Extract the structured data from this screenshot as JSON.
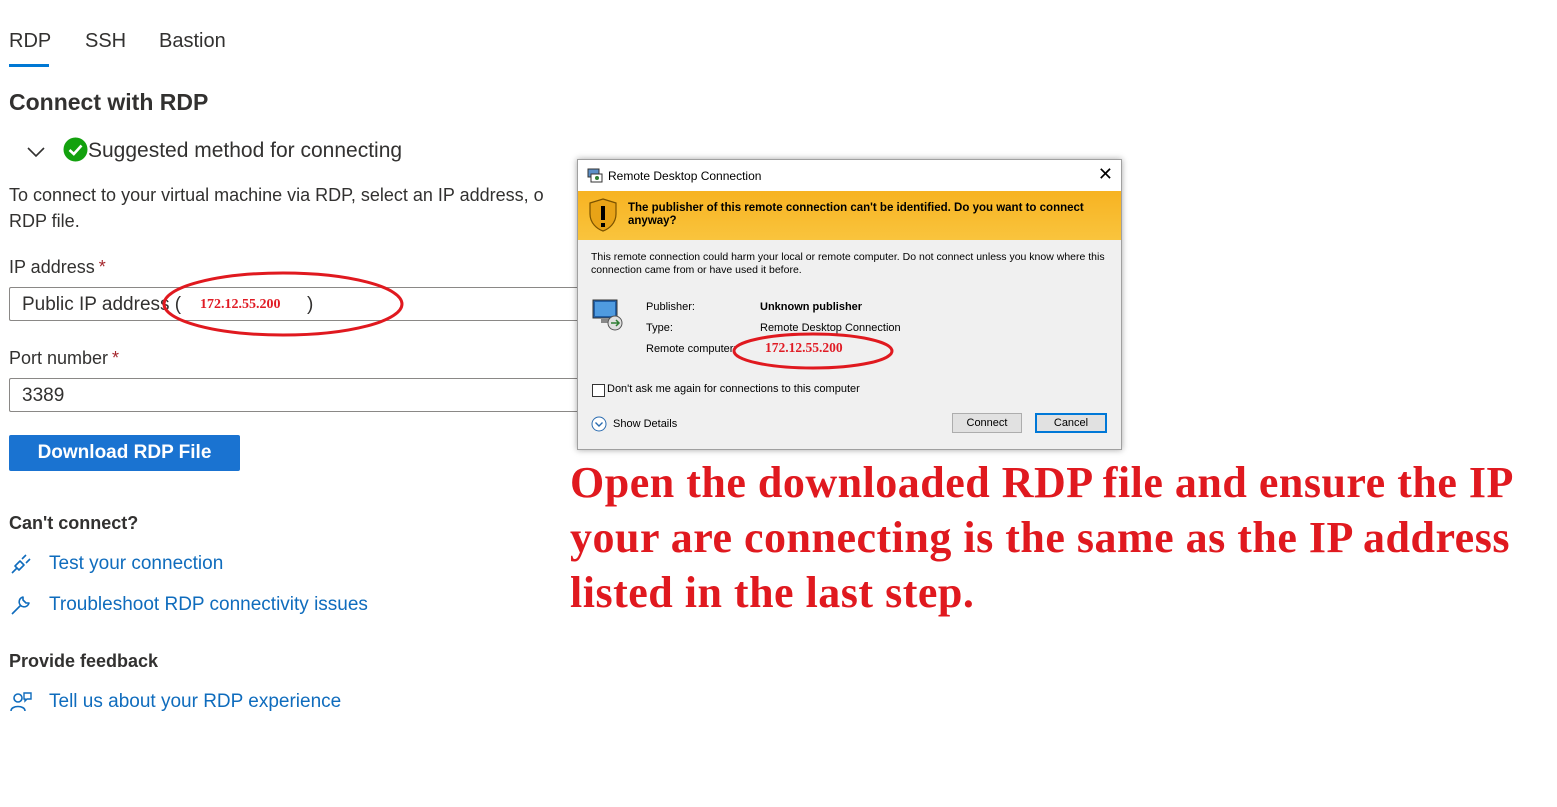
{
  "tabs": [
    {
      "label": "RDP",
      "active": true
    },
    {
      "label": "SSH",
      "active": false
    },
    {
      "label": "Bastion",
      "active": false
    }
  ],
  "page_title": "Connect with RDP",
  "section": {
    "title": "Suggested method for connecting"
  },
  "description": {
    "line1": "To connect to your virtual machine via RDP, select an IP address, o",
    "line2": "RDP file."
  },
  "ip_field": {
    "label": "IP address",
    "required_mark": "*",
    "value_prefix": "Public IP address (",
    "value_suffix": ")",
    "annotated_ip": "172.12.55.200"
  },
  "port_field": {
    "label": "Port number",
    "required_mark": "*",
    "value": "3389"
  },
  "download_button": "Download RDP File",
  "cant_connect": {
    "heading": "Can't connect?",
    "links": [
      {
        "label": "Test your connection",
        "icon": "plug-icon"
      },
      {
        "label": "Troubleshoot RDP connectivity issues",
        "icon": "wrench-icon"
      }
    ]
  },
  "feedback": {
    "heading": "Provide feedback",
    "link": {
      "label": "Tell us about your RDP experience",
      "icon": "feedback-person-icon"
    }
  },
  "dialog": {
    "title": "Remote Desktop Connection",
    "warning": "The publisher of this remote connection can't be identified. Do you want to connect anyway?",
    "body": "This remote connection could harm your local or remote computer. Do not connect unless you know where this connection came from or have used it before.",
    "publisher_label": "Publisher:",
    "publisher_value": "Unknown publisher",
    "type_label": "Type:",
    "type_value": "Remote Desktop Connection",
    "remote_label": "Remote computer:",
    "remote_value": "172.12.55.200",
    "checkbox_label": "Don't ask me again for connections to this computer",
    "show_details": "Show Details",
    "connect_button": "Connect",
    "cancel_button": "Cancel"
  },
  "annotation": {
    "text": "Open the downloaded RDP file and ensure the IP your are connecting is the same as the IP address listed in the last step.",
    "color": "#e0191f"
  },
  "colors": {
    "accent": "#0078d4",
    "link": "#0f6cbd",
    "success": "#13a10e",
    "annotation_red": "#e0191f",
    "warning_bar": "#f9c43d"
  }
}
